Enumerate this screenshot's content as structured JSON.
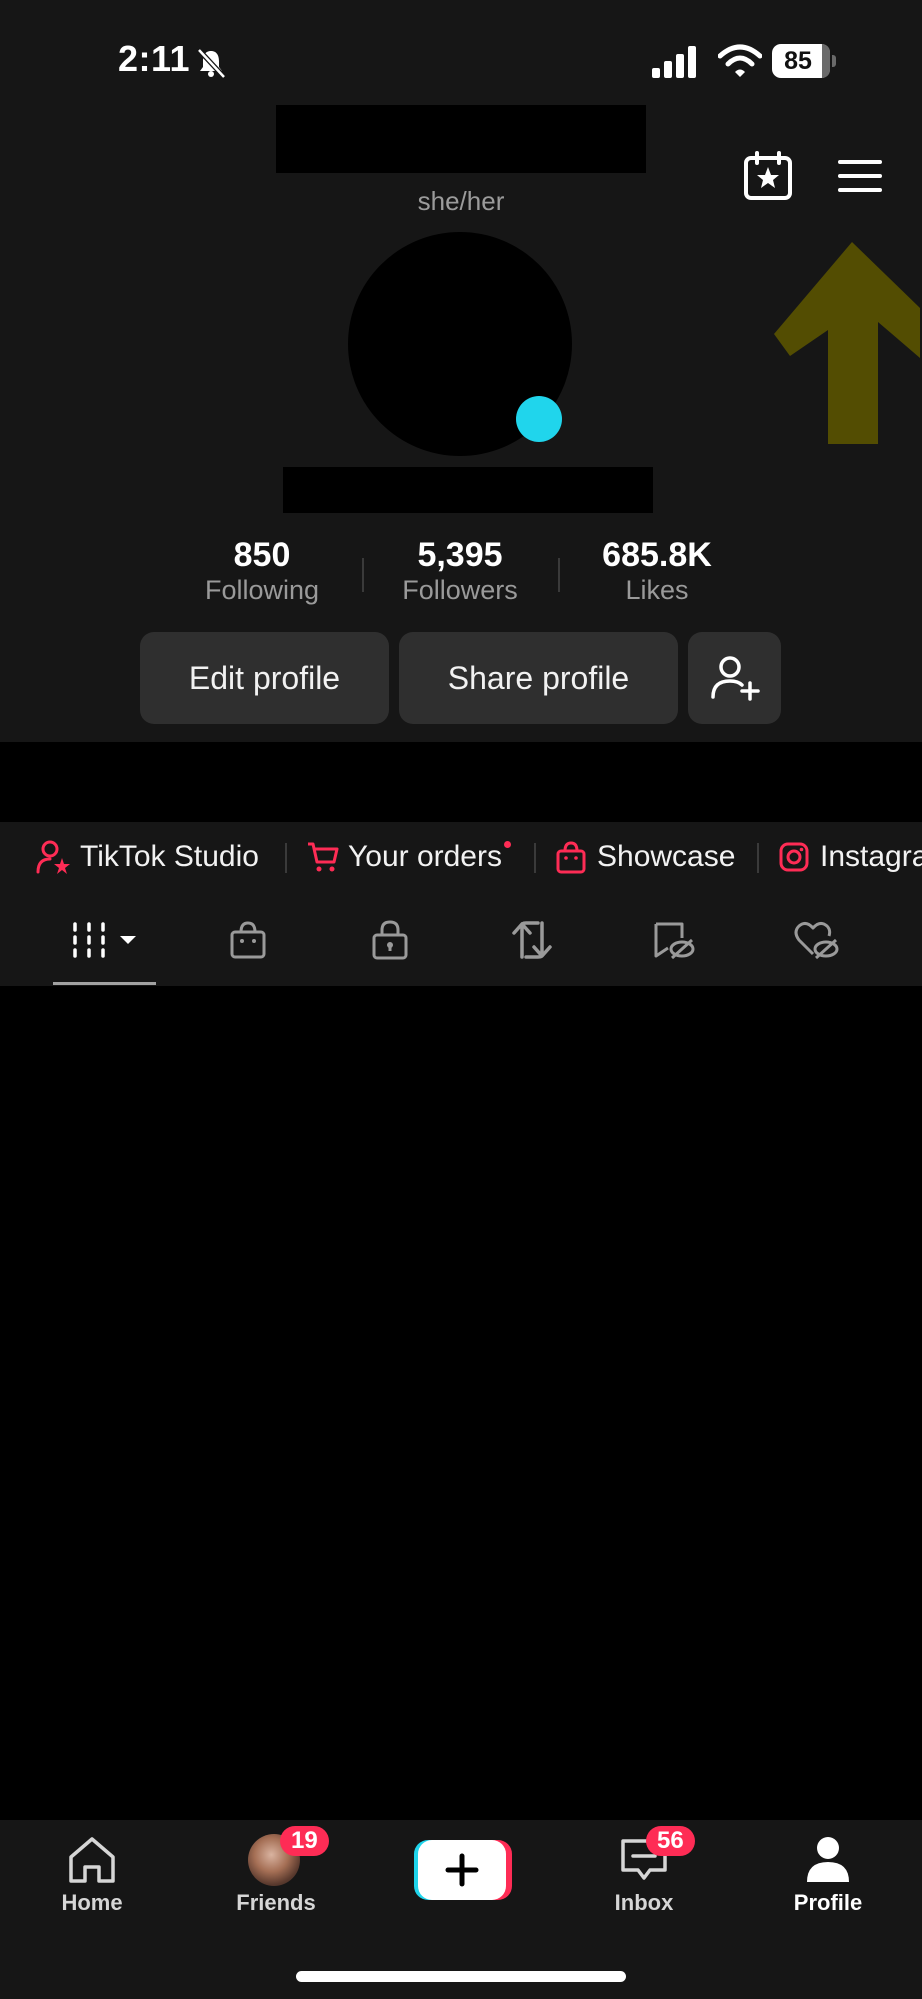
{
  "status_bar": {
    "time": "2:11",
    "battery": "85"
  },
  "profile": {
    "pronouns": "she/her",
    "stats": [
      {
        "value": "850",
        "label": "Following"
      },
      {
        "value": "5,395",
        "label": "Followers"
      },
      {
        "value": "685.8K",
        "label": "Likes"
      }
    ],
    "buttons": {
      "edit": "Edit profile",
      "share": "Share profile"
    }
  },
  "shortcuts": [
    {
      "label": "TikTok Studio",
      "icon": "user-star-icon"
    },
    {
      "label": "Your orders",
      "icon": "cart-icon"
    },
    {
      "label": "Showcase",
      "icon": "bag-icon"
    },
    {
      "label": "Instagram",
      "icon": "instagram-icon"
    }
  ],
  "tabs": [
    "videos-grid",
    "shop",
    "private",
    "reposts",
    "hidden",
    "liked-hidden"
  ],
  "nav": {
    "home": "Home",
    "friends": "Friends",
    "friends_badge": "19",
    "inbox": "Inbox",
    "inbox_badge": "56",
    "profile": "Profile"
  },
  "colors": {
    "accent": "#fe2c55",
    "badge_cyan": "#20d5ec",
    "arrow": "#6b6300"
  }
}
